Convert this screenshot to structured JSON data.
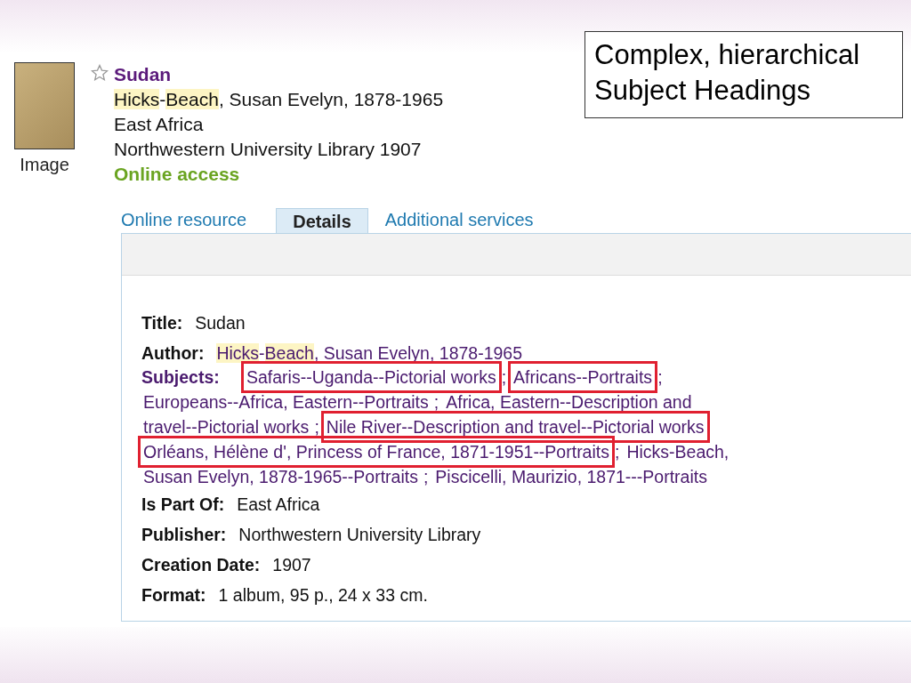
{
  "callout": {
    "lines": [
      "Complex, hierarchical",
      "Subject Headings"
    ]
  },
  "record": {
    "thumbnail_label": "Image",
    "starred": false,
    "title": "Sudan",
    "author": [
      {
        "text": "Hicks",
        "highlight": true
      },
      {
        "text": "-",
        "highlight": false
      },
      {
        "text": "Beach",
        "highlight": true
      },
      {
        "text": ", Susan Evelyn, 1878-1965",
        "highlight": false
      }
    ],
    "series": "East Africa",
    "publisher_line": "Northwestern University Library 1907",
    "access": "Online access"
  },
  "tabs": [
    {
      "label": "Online resource",
      "selected": false
    },
    {
      "label": "Details",
      "selected": true
    },
    {
      "label": "Additional services",
      "selected": false
    }
  ],
  "details": {
    "title_label": "Title:",
    "title": "Sudan",
    "author_label": "Author:",
    "author": [
      {
        "text": "Hicks",
        "highlight": true
      },
      {
        "text": "-",
        "highlight": false
      },
      {
        "text": "Beach",
        "highlight": true
      },
      {
        "text": ", Susan Evelyn, 1878-1965",
        "highlight": false
      }
    ],
    "subjects_label": "Subjects:",
    "subjects": [
      [
        {
          "text": "Safaris--Uganda--Pictorial works",
          "boxed": true,
          "sep": ";"
        },
        {
          "text": "Africans--Portraits",
          "boxed": true,
          "sep": ";"
        }
      ],
      [
        {
          "text": "Europeans--Africa, Eastern--Portraits",
          "boxed": false,
          "sep": ";"
        },
        {
          "text": "Africa, Eastern--Description and",
          "boxed": false
        }
      ],
      [
        {
          "text": "travel--Pictorial works",
          "boxed": false,
          "sep": ";"
        },
        {
          "text": "Nile River--Description and travel--Pictorial works",
          "boxed": true
        }
      ],
      [
        {
          "text": "Orléans, Hélène d', Princess of France, 1871-1951--Portraits",
          "boxed": true,
          "sep": ";"
        },
        {
          "text": "Hicks-Beach,",
          "boxed": false
        }
      ],
      [
        {
          "text": "Susan Evelyn, 1878-1965--Portraits",
          "boxed": false,
          "sep": ";"
        },
        {
          "text": "Piscicelli, Maurizio, 1871---Portraits",
          "boxed": false
        }
      ]
    ],
    "fields": [
      {
        "label": "Is Part Of:",
        "value": "East Africa"
      },
      {
        "label": "Publisher:",
        "value": "Northwestern University Library"
      },
      {
        "label": "Creation Date:",
        "value": "1907"
      },
      {
        "label": "Format:",
        "value": "1 album, 95 p., 24 x 33 cm."
      }
    ]
  }
}
